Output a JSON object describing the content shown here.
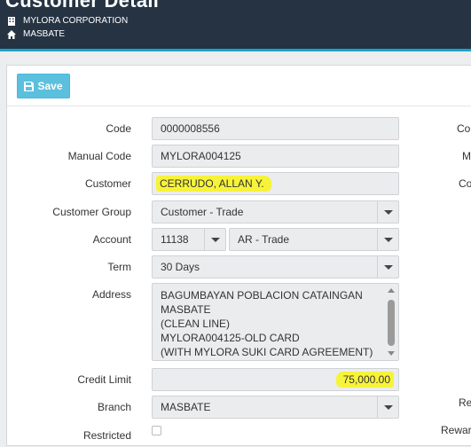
{
  "header": {
    "title": "Customer Detail",
    "company": "MYLORA CORPORATION",
    "branch": "MASBATE"
  },
  "toolbar": {
    "save_label": "Save"
  },
  "form": {
    "code": {
      "label": "Code",
      "value": "0000008556"
    },
    "manual_code": {
      "label": "Manual Code",
      "value": "MYLORA004125"
    },
    "customer": {
      "label": "Customer",
      "value": "CERRUDO, ALLAN Y."
    },
    "customer_group": {
      "label": "Customer Group",
      "value": "Customer - Trade"
    },
    "account": {
      "label": "Account",
      "code": "11138",
      "name": "AR - Trade"
    },
    "term": {
      "label": "Term",
      "value": "30 Days"
    },
    "address": {
      "label": "Address",
      "lines": [
        "BAGUMBAYAN POBLACION CATAINGAN",
        "MASBATE",
        "(CLEAN LINE)",
        "MYLORA004125-OLD CARD",
        "(WITH MYLORA SUKI CARD AGREEMENT)"
      ]
    },
    "credit_limit": {
      "label": "Credit Limit",
      "value": "75,000.00"
    },
    "branch": {
      "label": "Branch",
      "value": "MASBATE"
    },
    "restricted": {
      "label": "Restricted"
    }
  },
  "right_labels": [
    "Co",
    "M",
    "Co",
    "Re",
    "Reward"
  ],
  "colors": {
    "header_bg": "#253343",
    "accent": "#1aa3c9",
    "save_button": "#5bc0de",
    "highlight": "#f7f33a"
  }
}
